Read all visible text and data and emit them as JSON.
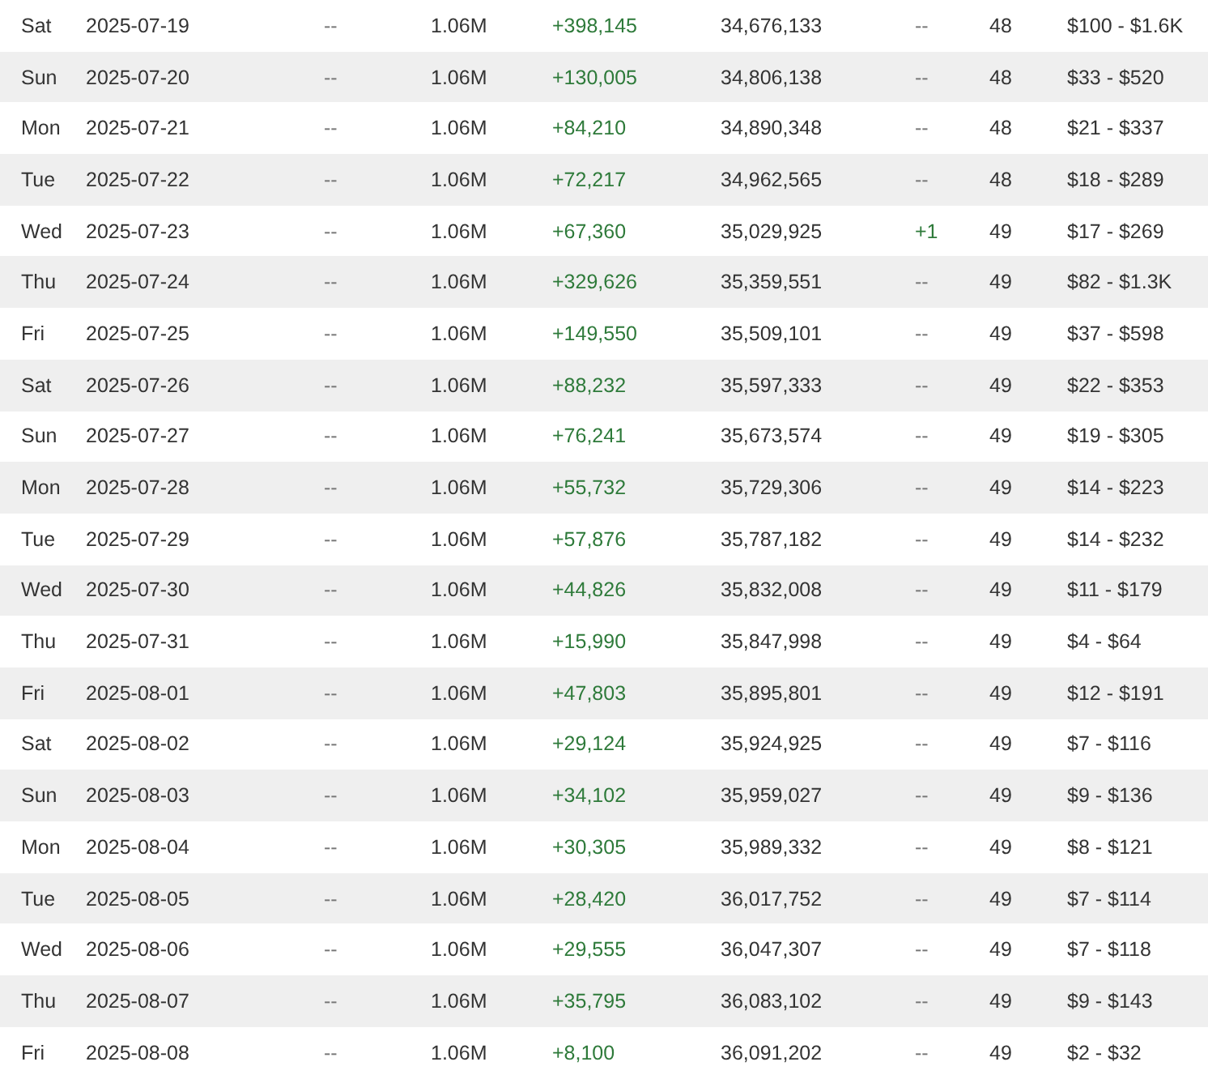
{
  "table": {
    "rows": [
      {
        "day": "Sat",
        "date": "2025-07-19",
        "column_3": "--",
        "column_4": "1.06M",
        "change": "+398,145",
        "total": "34,676,133",
        "column_7": "--",
        "column_7_gain": false,
        "column_8": "48",
        "column_9": "$100 - $1.6K"
      },
      {
        "day": "Sun",
        "date": "2025-07-20",
        "column_3": "--",
        "column_4": "1.06M",
        "change": "+130,005",
        "total": "34,806,138",
        "column_7": "--",
        "column_7_gain": false,
        "column_8": "48",
        "column_9": "$33 - $520"
      },
      {
        "day": "Mon",
        "date": "2025-07-21",
        "column_3": "--",
        "column_4": "1.06M",
        "change": "+84,210",
        "total": "34,890,348",
        "column_7": "--",
        "column_7_gain": false,
        "column_8": "48",
        "column_9": "$21 - $337"
      },
      {
        "day": "Tue",
        "date": "2025-07-22",
        "column_3": "--",
        "column_4": "1.06M",
        "change": "+72,217",
        "total": "34,962,565",
        "column_7": "--",
        "column_7_gain": false,
        "column_8": "48",
        "column_9": "$18 - $289"
      },
      {
        "day": "Wed",
        "date": "2025-07-23",
        "column_3": "--",
        "column_4": "1.06M",
        "change": "+67,360",
        "total": "35,029,925",
        "column_7": "+1",
        "column_7_gain": true,
        "column_8": "49",
        "column_9": "$17 - $269"
      },
      {
        "day": "Thu",
        "date": "2025-07-24",
        "column_3": "--",
        "column_4": "1.06M",
        "change": "+329,626",
        "total": "35,359,551",
        "column_7": "--",
        "column_7_gain": false,
        "column_8": "49",
        "column_9": "$82 - $1.3K"
      },
      {
        "day": "Fri",
        "date": "2025-07-25",
        "column_3": "--",
        "column_4": "1.06M",
        "change": "+149,550",
        "total": "35,509,101",
        "column_7": "--",
        "column_7_gain": false,
        "column_8": "49",
        "column_9": "$37 - $598"
      },
      {
        "day": "Sat",
        "date": "2025-07-26",
        "column_3": "--",
        "column_4": "1.06M",
        "change": "+88,232",
        "total": "35,597,333",
        "column_7": "--",
        "column_7_gain": false,
        "column_8": "49",
        "column_9": "$22 - $353"
      },
      {
        "day": "Sun",
        "date": "2025-07-27",
        "column_3": "--",
        "column_4": "1.06M",
        "change": "+76,241",
        "total": "35,673,574",
        "column_7": "--",
        "column_7_gain": false,
        "column_8": "49",
        "column_9": "$19 - $305"
      },
      {
        "day": "Mon",
        "date": "2025-07-28",
        "column_3": "--",
        "column_4": "1.06M",
        "change": "+55,732",
        "total": "35,729,306",
        "column_7": "--",
        "column_7_gain": false,
        "column_8": "49",
        "column_9": "$14 - $223"
      },
      {
        "day": "Tue",
        "date": "2025-07-29",
        "column_3": "--",
        "column_4": "1.06M",
        "change": "+57,876",
        "total": "35,787,182",
        "column_7": "--",
        "column_7_gain": false,
        "column_8": "49",
        "column_9": "$14 - $232"
      },
      {
        "day": "Wed",
        "date": "2025-07-30",
        "column_3": "--",
        "column_4": "1.06M",
        "change": "+44,826",
        "total": "35,832,008",
        "column_7": "--",
        "column_7_gain": false,
        "column_8": "49",
        "column_9": "$11 - $179"
      },
      {
        "day": "Thu",
        "date": "2025-07-31",
        "column_3": "--",
        "column_4": "1.06M",
        "change": "+15,990",
        "total": "35,847,998",
        "column_7": "--",
        "column_7_gain": false,
        "column_8": "49",
        "column_9": "$4 - $64"
      },
      {
        "day": "Fri",
        "date": "2025-08-01",
        "column_3": "--",
        "column_4": "1.06M",
        "change": "+47,803",
        "total": "35,895,801",
        "column_7": "--",
        "column_7_gain": false,
        "column_8": "49",
        "column_9": "$12 - $191"
      },
      {
        "day": "Sat",
        "date": "2025-08-02",
        "column_3": "--",
        "column_4": "1.06M",
        "change": "+29,124",
        "total": "35,924,925",
        "column_7": "--",
        "column_7_gain": false,
        "column_8": "49",
        "column_9": "$7 - $116"
      },
      {
        "day": "Sun",
        "date": "2025-08-03",
        "column_3": "--",
        "column_4": "1.06M",
        "change": "+34,102",
        "total": "35,959,027",
        "column_7": "--",
        "column_7_gain": false,
        "column_8": "49",
        "column_9": "$9 - $136"
      },
      {
        "day": "Mon",
        "date": "2025-08-04",
        "column_3": "--",
        "column_4": "1.06M",
        "change": "+30,305",
        "total": "35,989,332",
        "column_7": "--",
        "column_7_gain": false,
        "column_8": "49",
        "column_9": "$8 - $121"
      },
      {
        "day": "Tue",
        "date": "2025-08-05",
        "column_3": "--",
        "column_4": "1.06M",
        "change": "+28,420",
        "total": "36,017,752",
        "column_7": "--",
        "column_7_gain": false,
        "column_8": "49",
        "column_9": "$7 - $114"
      },
      {
        "day": "Wed",
        "date": "2025-08-06",
        "column_3": "--",
        "column_4": "1.06M",
        "change": "+29,555",
        "total": "36,047,307",
        "column_7": "--",
        "column_7_gain": false,
        "column_8": "49",
        "column_9": "$7 - $118"
      },
      {
        "day": "Thu",
        "date": "2025-08-07",
        "column_3": "--",
        "column_4": "1.06M",
        "change": "+35,795",
        "total": "36,083,102",
        "column_7": "--",
        "column_7_gain": false,
        "column_8": "49",
        "column_9": "$9 - $143"
      },
      {
        "day": "Fri",
        "date": "2025-08-08",
        "column_3": "--",
        "column_4": "1.06M",
        "change": "+8,100",
        "total": "36,091,202",
        "column_7": "--",
        "column_7_gain": false,
        "column_8": "49",
        "column_9": "$2 - $32"
      }
    ]
  }
}
